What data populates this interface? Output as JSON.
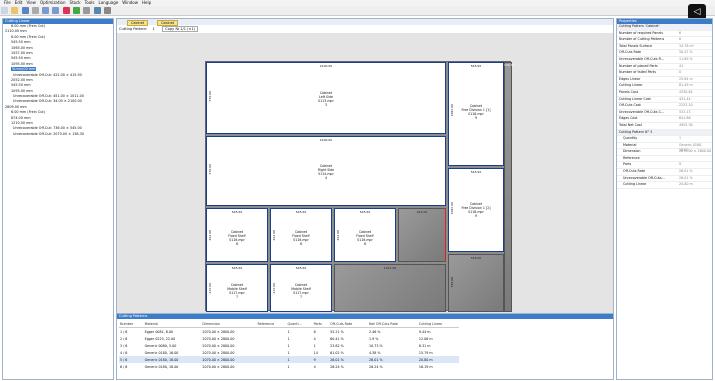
{
  "menu": [
    "File",
    "Edit",
    "View",
    "Optimization",
    "Stock",
    "Tools",
    "Language",
    "Window",
    "Help"
  ],
  "left_panel": {
    "title": "Cutting Linear",
    "rows": [
      "6.00 mm (Frein Cut)",
      "2110.00 mm",
      "6.00 mm (Frein Cut)",
      "545.50 mm",
      "1565.00 mm",
      "1557.00 mm",
      "545.50 mm",
      "1095.00 mm",
      "5(mm)00 mm",
      "Unrecoverable Off-Cut: 422.00 × 415.50",
      "2052.00 mm",
      "545.50 mm",
      "1095.00 mm",
      "Unrecoverable Off-Cut: 451.00 × 1011.00",
      "Unrecoverable Off-Cut: 34.00 × 2100.00",
      "2809.00 mm",
      "6.00 mm (Frein Cut)",
      "874.00 mm",
      "1210.00 mm",
      "Unrecoverable Off-Cut: 736.00 × 545.00",
      "Unrecoverable Off-Cut: 2070.00 × 136.30"
    ]
  },
  "tabs": [
    "Cabinet",
    "Cabinet"
  ],
  "pattern_bar": {
    "label": "Cutting Pattern:",
    "value": "1",
    "copy": "Copy № 1/1 (×1)"
  },
  "parts": [
    {
      "title": "Cabinet\nLeft Side\n0113.mpr\n3",
      "dim_top": "2100.00",
      "dim_side": "570.00"
    },
    {
      "title": "Cabinet\nRight Side\n0114.mpr\n4",
      "dim_top": "2100.00",
      "dim_side": "570.00"
    },
    {
      "title": "Cabinet\nFree Division 1 [1]\n0118.mpr\n9",
      "dim_top": "545.50",
      "dim_side": "1095.00"
    },
    {
      "title": "Cabinet\nFree Division 1 [2]\n0118.mpr\n9",
      "dim_top": "545.50",
      "dim_side": "1095.00"
    },
    {
      "title": "Cabinet\nFixed Shelf\n0116.mpr\n6",
      "dim_top": "545.50",
      "dim_side": "422.00"
    },
    {
      "title": "Cabinet\nFixed Shelf\n0116.mpr\n6",
      "dim_top": "545.50",
      "dim_side": "422.00"
    },
    {
      "title": "Cabinet\nFixed Shelf\n0116.mpr\n6",
      "dim_top": "545.50",
      "dim_side": "422.00"
    },
    {
      "title": "Cabinet\nMobile Shelf\n0117.mpr\n7",
      "dim_top": "545.50",
      "dim_side": "415.00"
    },
    {
      "title": "Cabinet\nMobile Shelf\n0117.mpr\n7",
      "dim_top": "545.50",
      "dim_side": "415.00"
    }
  ],
  "offcuts": [
    {
      "dim": "136.30"
    },
    {
      "dim": "451.00"
    },
    {
      "dim": "1011.00"
    },
    {
      "dim": "545.00"
    },
    {
      "dim": "736.00"
    }
  ],
  "bottom_panel": {
    "title": "Cutting Patterns",
    "columns": [
      "Number",
      "Material",
      "Dimension",
      "Reference",
      "Quanti...",
      "Parts",
      "Off-Cuts Rate",
      "Net Off-Cuts Rate",
      "Cutting Linear"
    ],
    "rows": [
      [
        "1 / 6",
        "Egger 0081, 6.00",
        "2070.00 × 2800.00",
        "",
        "1",
        "6",
        "55.21 %",
        "2.46 %",
        "9.44 m"
      ],
      [
        "2 / 6",
        "Egger 0225, 22.00",
        "2070.00 × 2800.00",
        "",
        "1",
        "4",
        "60.41 %",
        "1.9 %",
        "12.06 m"
      ],
      [
        "3 / 6",
        "Generic 0080, 5.00",
        "2070.00 × 2800.00",
        "",
        "1",
        "1",
        "23.82 %",
        "10.73 %",
        "8.31 m"
      ],
      [
        "4 / 6",
        "Generic 0180, 16.00",
        "2070.00 × 2800.00",
        "",
        "1",
        "14",
        "61.02 %",
        "4.38 %",
        "15.79 m"
      ],
      [
        "5 / 6",
        "Generic 0180, 18.00",
        "2070.00 × 2800.00",
        "",
        "1",
        "9",
        "26.01 %",
        "26.01 %",
        "20.80 m"
      ],
      [
        "6 / 6",
        "Generic 0180, 18.00",
        "2070.00 × 2800.00",
        "",
        "1",
        "4",
        "26.24 %",
        "26.24 %",
        "16.19 m"
      ]
    ]
  },
  "right_panel": {
    "title": "Properties",
    "subtitle": "Cutting Pattern 'Cabinet'",
    "rows": [
      {
        "k": "Number of required Panels",
        "v": "6"
      },
      {
        "k": "Number of Cutting Patterns",
        "v": "6"
      },
      {
        "k": "Total Panels Surface",
        "v": "34.78 m²"
      },
      {
        "k": "Off-Cuts Rate",
        "v": "50.47 %"
      },
      {
        "k": "Unrecoverable Off-Cuts R...",
        "v": "11.89 %"
      },
      {
        "k": "Number of placed Parts",
        "v": "41"
      },
      {
        "k": "Number of failed Parts",
        "v": "0"
      },
      {
        "k": "Edges Linear",
        "v": "25.84 m"
      },
      {
        "k": "Cutting Linear",
        "v": "81.49 m"
      },
      {
        "k": "Panels Cost",
        "v": "4330.62"
      },
      {
        "k": "Cutting Linear Cost",
        "v": "431.44"
      },
      {
        "k": "Off-Cuts Cost",
        "v": "2253.10"
      },
      {
        "k": "Unrecoverable Off-Cuts C...",
        "v": "532.13"
      },
      {
        "k": "Edges Cost",
        "v": "641.86"
      },
      {
        "k": "Total Net Cost",
        "v": "4953.30"
      },
      {
        "k": "Cutting Pattern N° 5",
        "v": "",
        "hdr": true
      },
      {
        "k": "Quantity",
        "v": "1",
        "sub": true
      },
      {
        "k": "Material",
        "v": "Generic 0180, 18.00",
        "sub": true
      },
      {
        "k": "Dimension",
        "v": "2070.00 × 2800.00",
        "sub": true
      },
      {
        "k": "Reference",
        "v": "",
        "sub": true
      },
      {
        "k": "Parts",
        "v": "9",
        "sub": true
      },
      {
        "k": "Off-Cuts Rate",
        "v": "26.01 %",
        "sub": true
      },
      {
        "k": "Unrecoverable Off-Cuts...",
        "v": "26.01 %",
        "sub": true
      },
      {
        "k": "Cutting Linear",
        "v": "20.80 m",
        "sub": true
      }
    ]
  }
}
